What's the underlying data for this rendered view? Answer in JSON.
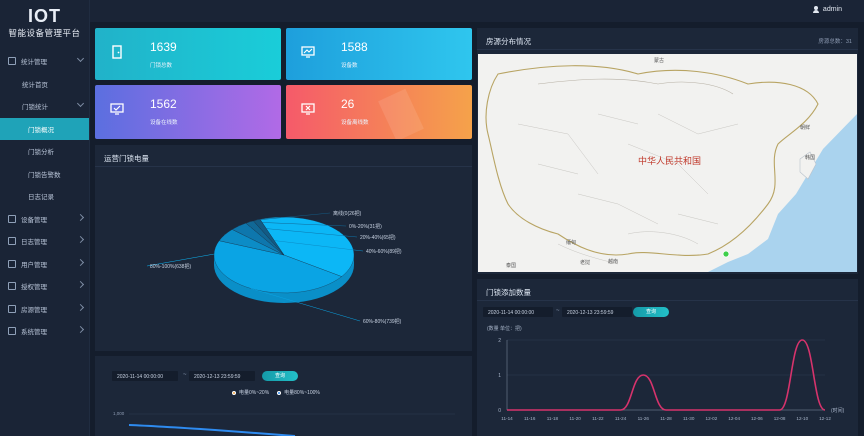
{
  "app": {
    "logo_mark": "IOT",
    "title": "智能设备管理平台"
  },
  "user": {
    "name": "admin"
  },
  "sidebar": {
    "items": [
      {
        "label": "统计管理",
        "level": 0,
        "chevron": "down"
      },
      {
        "label": "统计首页",
        "level": 1
      },
      {
        "label": "门锁统计",
        "level": 1,
        "chevron": "down"
      },
      {
        "label": "门锁概况",
        "level": 2,
        "active": true
      },
      {
        "label": "门锁分析",
        "level": 2
      },
      {
        "label": "门锁告警数",
        "level": 2
      },
      {
        "label": "日志记录",
        "level": 2
      },
      {
        "label": "设备管理",
        "level": 0,
        "chevron": "right"
      },
      {
        "label": "日志管理",
        "level": 0,
        "chevron": "right"
      },
      {
        "label": "用户管理",
        "level": 0,
        "chevron": "right"
      },
      {
        "label": "授权管理",
        "level": 0,
        "chevron": "right"
      },
      {
        "label": "房源管理",
        "level": 0,
        "chevron": "right"
      },
      {
        "label": "系统管理",
        "level": 0,
        "chevron": "right"
      }
    ]
  },
  "stats": [
    {
      "value": "1639",
      "label": "门锁总数",
      "icon": "door-icon"
    },
    {
      "value": "1588",
      "label": "设备数",
      "icon": "monitor-chart-icon"
    },
    {
      "value": "1562",
      "label": "设备在线数",
      "icon": "monitor-check-icon"
    },
    {
      "value": "26",
      "label": "设备离线数",
      "icon": "monitor-close-icon"
    }
  ],
  "pie_panel": {
    "title": "运营门锁电量"
  },
  "map_panel": {
    "title": "房源分布情况",
    "count_label": "房源总数：31",
    "country_label": "中华人民共和国",
    "region_labels": [
      "蒙古",
      "朝鲜",
      "韩国",
      "缅甸",
      "越南",
      "老挝",
      "泰国"
    ]
  },
  "bar_panel": {
    "title": "门锁添加数量",
    "start": "2020-11-14 00:00:00",
    "end": "2020-12-13 23:59:59",
    "query": "查询",
    "unit_note": "(数量  单位：把)",
    "axis_name": "(时间)"
  },
  "line_panel": {
    "start": "2020-11-14 00:00:00",
    "end": "2020-12-13 23:59:59",
    "query": "查询",
    "legend": [
      "电量0%~20%",
      "电量80%~100%"
    ],
    "y_top": "1,000"
  },
  "chart_data": [
    {
      "type": "pie",
      "title": "运营门锁电量",
      "slices": [
        {
          "name": "80%-100%",
          "label": "80%-100%(638把)",
          "value": 638,
          "color": "#0cb7f6"
        },
        {
          "name": "60%-80%",
          "label": "60%-80%(739把)",
          "value": 739,
          "color": "#0aa4e4"
        },
        {
          "name": "40%-60%",
          "label": "40%-60%(89把)",
          "value": 89,
          "color": "#0c8cc6"
        },
        {
          "name": "20%-40%",
          "label": "20%-40%(65把)",
          "value": 65,
          "color": "#0e77ad"
        },
        {
          "name": "0%-20%",
          "label": "0%-20%(31把)",
          "value": 31,
          "color": "#116896"
        },
        {
          "name": "离线",
          "label": "离线(0(26把)",
          "value": 26,
          "color": "#135b84"
        }
      ]
    },
    {
      "type": "line",
      "title": "门锁添加数量",
      "x": [
        "11-14",
        "11-16",
        "11-18",
        "11-20",
        "11-22",
        "11-24",
        "11-26",
        "11-28",
        "11-30",
        "12-02",
        "12-04",
        "12-06",
        "12-08",
        "12-10",
        "12-12"
      ],
      "series": [
        {
          "values": [
            0,
            0,
            0,
            0,
            0,
            0,
            1,
            0,
            0,
            0,
            0,
            0,
            0,
            2,
            0
          ]
        }
      ],
      "ylim": [
        0,
        2
      ],
      "yticks": [
        0,
        1,
        2
      ],
      "ylabel": "(数量  单位：把)",
      "xlabel": "(时间)",
      "color": "#d6336c"
    }
  ]
}
